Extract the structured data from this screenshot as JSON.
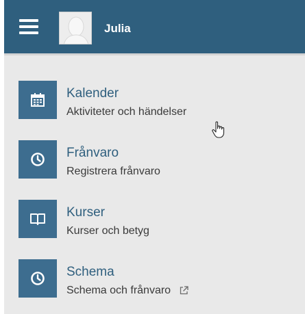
{
  "header": {
    "menu_icon": "hamburger-menu-icon",
    "avatar_icon": "avatar-placeholder-icon",
    "user_name": "Julia",
    "background_color": "#2f5f7e"
  },
  "menu": {
    "items": [
      {
        "icon": "calendar-icon",
        "title": "Kalender",
        "subtitle": "Aktiviteter och händelser"
      },
      {
        "icon": "clock-icon",
        "title": "Frånvaro",
        "subtitle": "Registrera frånvaro"
      },
      {
        "icon": "book-icon",
        "title": "Kurser",
        "subtitle": "Kurser och betyg"
      },
      {
        "icon": "clock-icon",
        "title": "Schema",
        "subtitle": "Schema och frånvaro",
        "trailing_icon": "external-link-icon"
      }
    ],
    "tile_color": "#3d6d8f",
    "title_color": "#2f5f7e"
  },
  "cursor_icon": "hand-pointer-icon"
}
